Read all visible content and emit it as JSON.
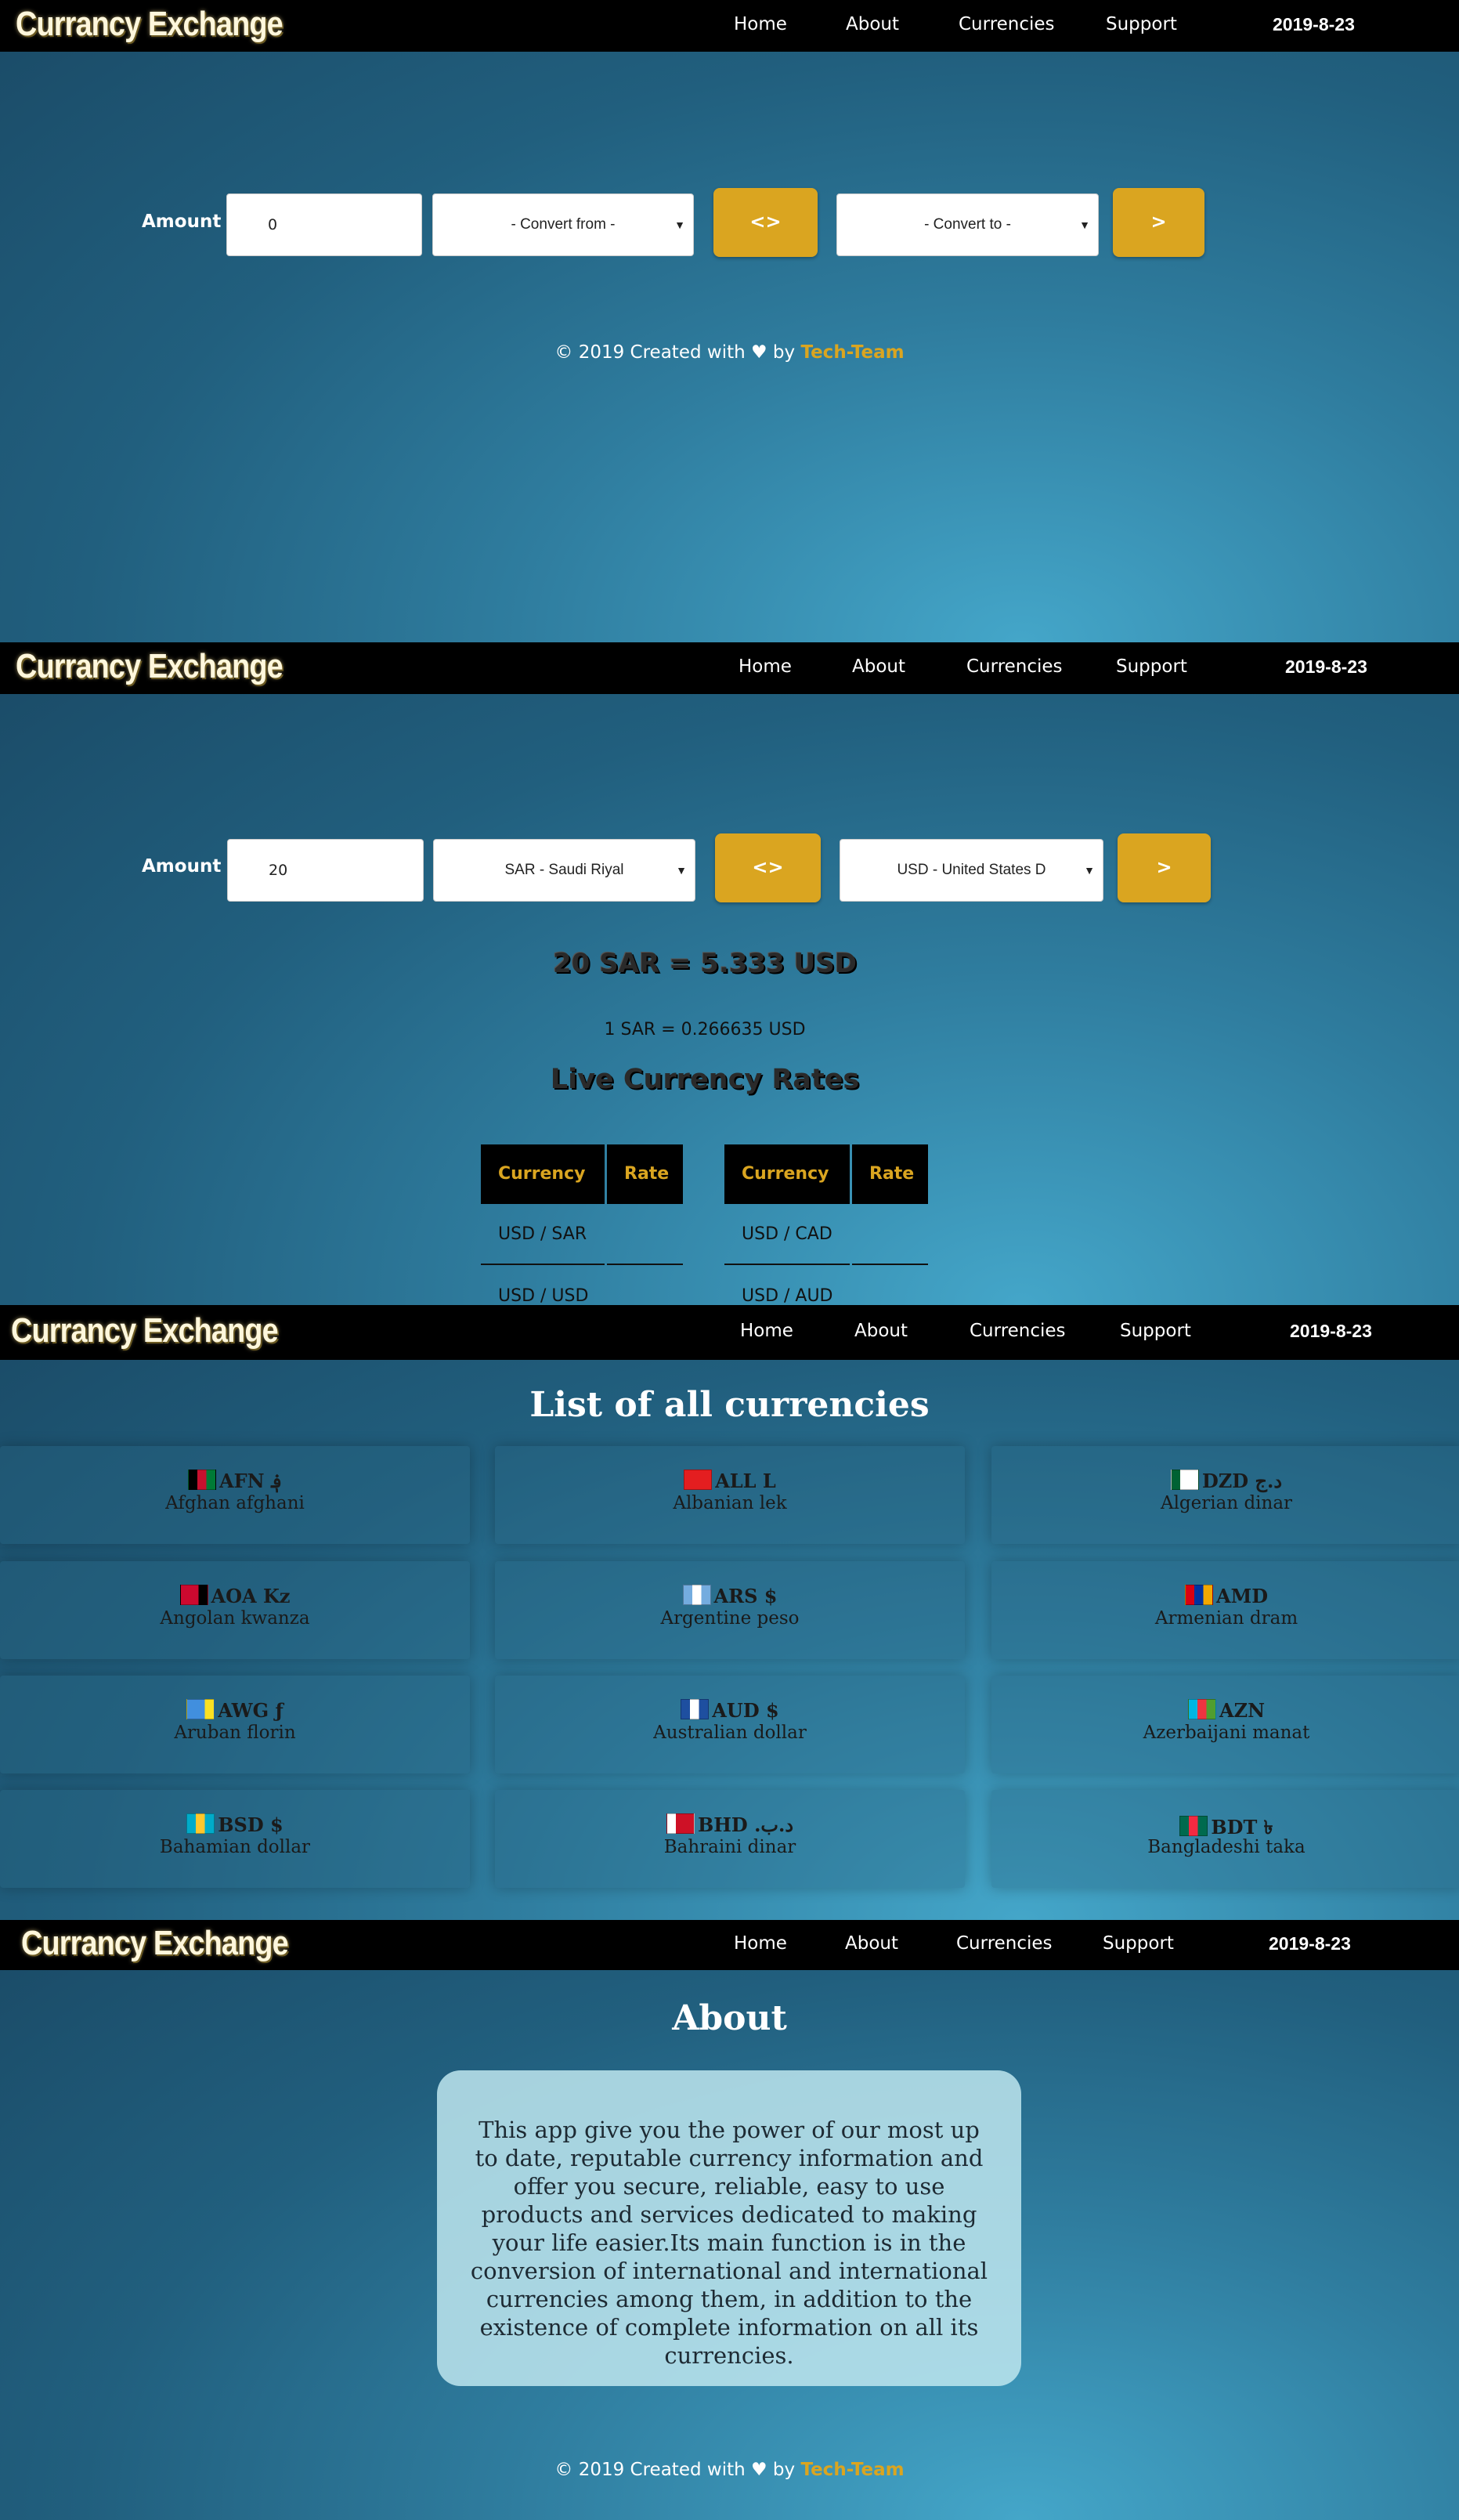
{
  "nav": {
    "brand": "Currancy Exchange",
    "links": [
      "Home",
      "About",
      "Currencies",
      "Support"
    ],
    "date": "2019-8-23"
  },
  "converter_empty": {
    "amount_label": "Amount",
    "amount_value": "0",
    "from_placeholder": "- Convert from -",
    "swap_label": "<>",
    "to_placeholder": "- Convert to -",
    "go_label": ">"
  },
  "converter_filled": {
    "amount_label": "Amount",
    "amount_value": "20",
    "from_value": "SAR - Saudi Riyal",
    "swap_label": "<>",
    "to_value": "USD - United States D",
    "go_label": ">",
    "result": "20 SAR = 5.333 USD",
    "unit_rate": "1 SAR = 0.266635 USD"
  },
  "live_rates": {
    "title": "Live Currency Rates",
    "col_currency": "Currency",
    "col_rate": "Rate",
    "left_rows": [
      "USD / SAR",
      "USD / USD"
    ],
    "right_rows": [
      "USD / CAD",
      "USD / AUD"
    ]
  },
  "footer": {
    "text": "© 2019 Created with ♥ by ",
    "team": "Tech-Team"
  },
  "currencies": {
    "title": "List of all currencies",
    "items": [
      {
        "code": "AFN ؋",
        "name": "Afghan afghani",
        "flag": [
          "#000000",
          "#c8102e",
          "#007a36"
        ]
      },
      {
        "code": "ALL L",
        "name": "Albanian lek",
        "flag": [
          "#e41e20",
          "#e41e20",
          "#e41e20"
        ]
      },
      {
        "code": "DZD د.ج",
        "name": "Algerian dinar",
        "flag": [
          "#006233",
          "#ffffff",
          "#ffffff"
        ]
      },
      {
        "code": "AOA Kz",
        "name": "Angolan kwanza",
        "flag": [
          "#cc092f",
          "#cc092f",
          "#000000"
        ]
      },
      {
        "code": "ARS $",
        "name": "Argentine peso",
        "flag": [
          "#74acdf",
          "#ffffff",
          "#74acdf"
        ]
      },
      {
        "code": "AMD",
        "name": "Armenian dram",
        "flag": [
          "#d90012",
          "#0033a0",
          "#f2a800"
        ]
      },
      {
        "code": "AWG ƒ",
        "name": "Aruban florin",
        "flag": [
          "#418fde",
          "#418fde",
          "#fbe122"
        ]
      },
      {
        "code": "AUD $",
        "name": "Australian dollar",
        "flag": [
          "#1e4fa0",
          "#ffffff",
          "#1e4fa0"
        ]
      },
      {
        "code": "AZN",
        "name": "Azerbaijani manat",
        "flag": [
          "#00b5e2",
          "#ef3340",
          "#509e2f"
        ]
      },
      {
        "code": "BSD $",
        "name": "Bahamian dollar",
        "flag": [
          "#00abc9",
          "#ffc72c",
          "#00abc9"
        ]
      },
      {
        "code": "BHD .د.ب",
        "name": "Bahraini dinar",
        "flag": [
          "#ffffff",
          "#ce1126",
          "#ce1126"
        ]
      },
      {
        "code": "BDT ৳",
        "name": "Bangladeshi taka",
        "flag": [
          "#006a4e",
          "#f42a41",
          "#006a4e"
        ]
      }
    ]
  },
  "about": {
    "title": "About",
    "text": "This app give you the power of our most up to date, reputable currency information and offer you secure, reliable, easy to use products and services dedicated to making your life easier.Its main function is in the conversion of international and international currencies among them, in addition to the existence of complete information on all its currencies."
  }
}
